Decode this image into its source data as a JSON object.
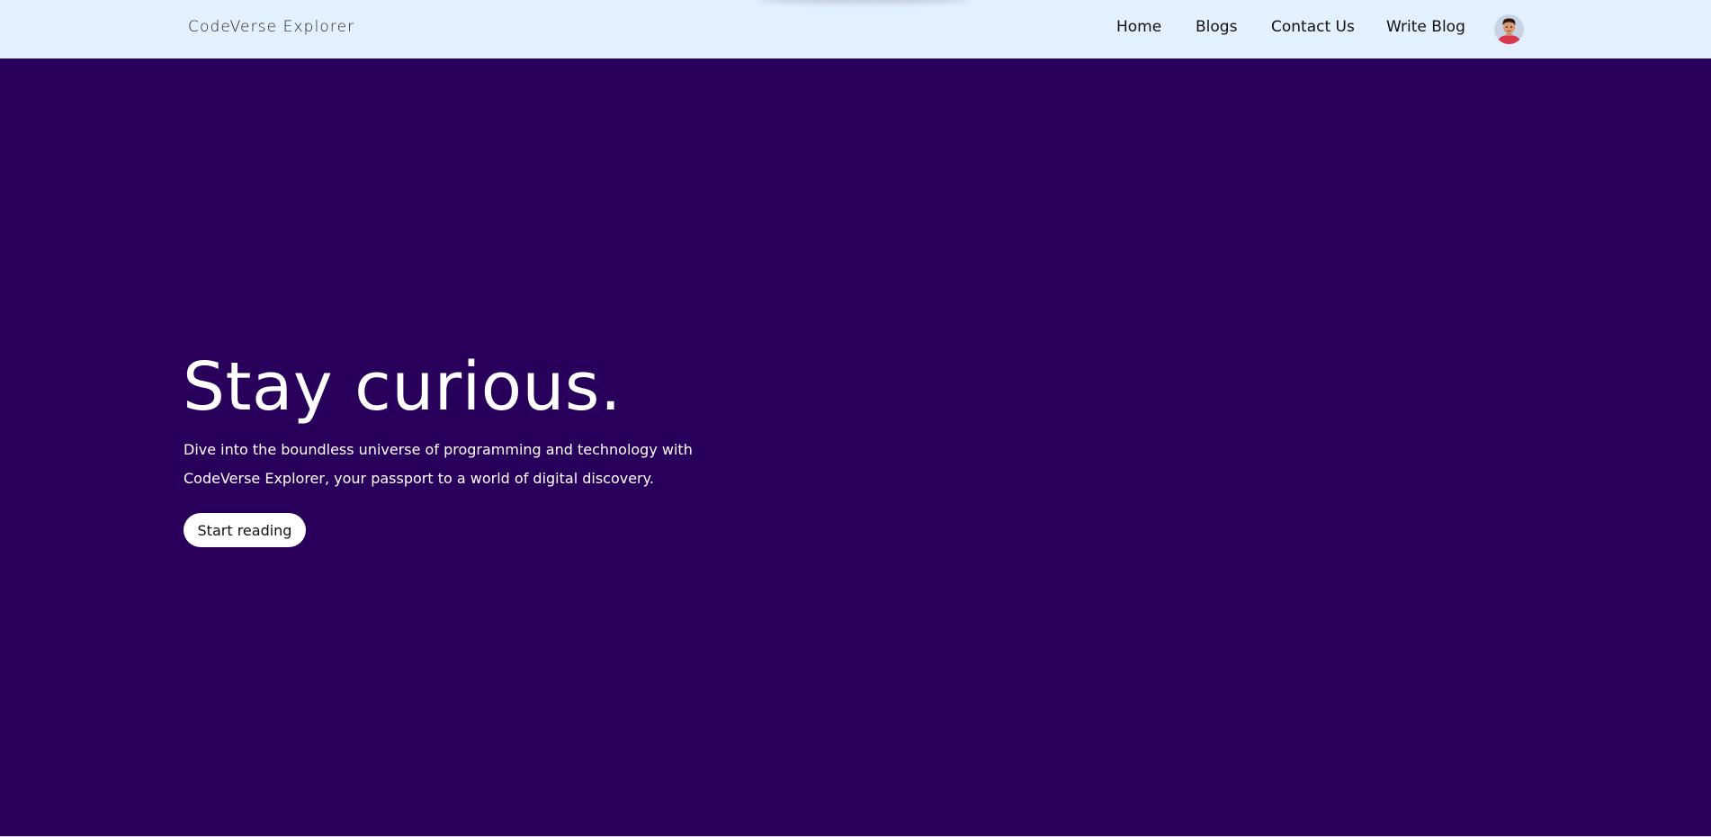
{
  "header": {
    "brand": "CodeVerse Explorer",
    "nav": [
      {
        "label": "Home"
      },
      {
        "label": "Blogs"
      },
      {
        "label": "Contact Us"
      },
      {
        "label": "Write Blog"
      }
    ],
    "avatar_icon": "user-avatar"
  },
  "hero": {
    "title": "Stay curious.",
    "description": "Dive into the boundless universe of programming and technology with CodeVerse Explorer, your passport to a world of digital discovery.",
    "cta_label": "Start reading"
  },
  "colors": {
    "navbar_bg": "#e3f0fd",
    "hero_bg": "#28005b",
    "text_light": "#ffffff",
    "text_dark": "#111111"
  }
}
